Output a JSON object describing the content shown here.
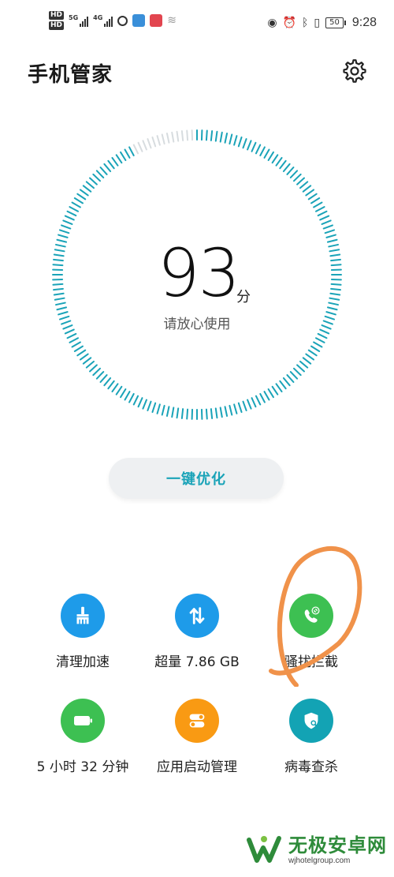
{
  "status_bar": {
    "hd1": "HD",
    "hd2": "HD",
    "sig1_label": "5G",
    "sig2_label": "4G",
    "battery": "50",
    "time": "9:28"
  },
  "header": {
    "title": "手机管家",
    "settings_icon": "gear-icon"
  },
  "score": {
    "value": "93",
    "unit": "分",
    "subtitle": "请放心使用",
    "fraction": 0.93
  },
  "optimize_button": "一键优化",
  "colors": {
    "accent": "#1aa3b8",
    "blue": "#1e9be9",
    "green": "#3dc052",
    "orange": "#f99a13",
    "teal": "#13a3b4",
    "annotation": "#f0924a"
  },
  "tools": [
    {
      "label": "清理加速",
      "icon": "broom-icon",
      "color": "#1e9be9"
    },
    {
      "label": "超量 7.86 GB",
      "icon": "data-transfer-icon",
      "color": "#1e9be9"
    },
    {
      "label": "骚扰拦截",
      "icon": "block-call-icon",
      "color": "#3dc052"
    },
    {
      "label": "5 小时 32 分钟",
      "icon": "battery-icon",
      "color": "#3dc052"
    },
    {
      "label": "应用启动管理",
      "icon": "toggle-icon",
      "color": "#f99a13"
    },
    {
      "label": "病毒查杀",
      "icon": "shield-search-icon",
      "color": "#13a3b4"
    }
  ],
  "watermark": {
    "name": "无极安卓网",
    "url": "wjhotelgroup.com"
  }
}
